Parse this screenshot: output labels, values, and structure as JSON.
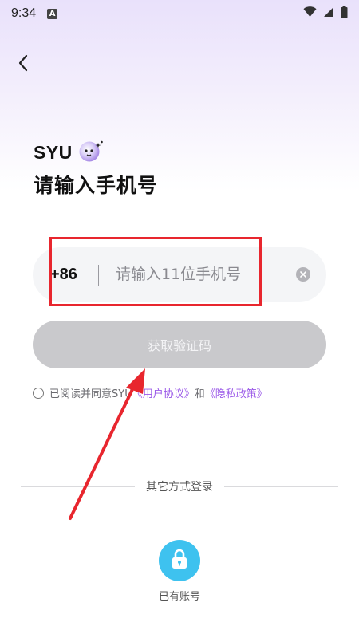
{
  "status_bar": {
    "time": "9:34",
    "notification_letter": "A",
    "icons": [
      "wifi-icon",
      "signal-icon",
      "battery-icon"
    ]
  },
  "header": {
    "back_icon": "chevron-left-icon"
  },
  "brand": {
    "name": "SYU",
    "mascot_icon": "mascot-icon"
  },
  "page_title": "请输入手机号",
  "phone_field": {
    "country_code": "+86",
    "placeholder": "请输入11位手机号",
    "value": "",
    "clear_icon": "clear-icon"
  },
  "get_code_button": "获取验证码",
  "agreement": {
    "prefix": "已阅读并同意SYU",
    "user_agreement": "《用户协议》",
    "and": "和",
    "privacy_policy": "《隐私政策》"
  },
  "other_login": {
    "divider_text": "其它方式登录",
    "account_icon": "lock-icon",
    "account_label": "已有账号"
  },
  "colors": {
    "accent_link": "#9a58e8",
    "lock_button": "#3ec2ef",
    "annotation_red": "#e8262e",
    "disabled_button": "#c9c9cc"
  }
}
